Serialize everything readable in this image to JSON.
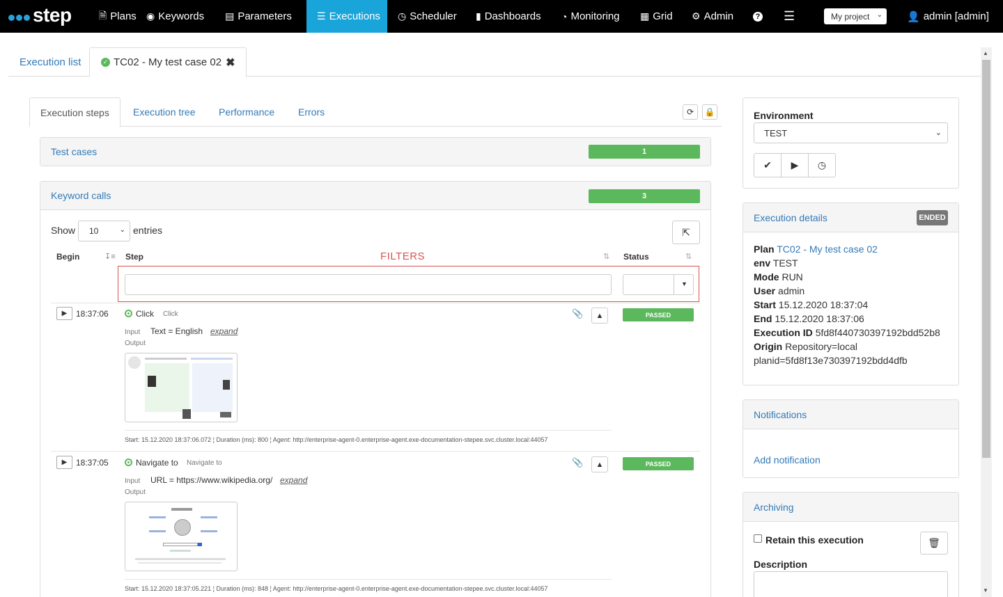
{
  "nav": {
    "brand": "step",
    "items": [
      {
        "label": "Plans",
        "icon": "file-icon"
      },
      {
        "label": "Keywords",
        "icon": "target-icon"
      },
      {
        "label": "Parameters",
        "icon": "list-icon"
      },
      {
        "label": "Executions",
        "icon": "tasks-icon"
      },
      {
        "label": "Scheduler",
        "icon": "clock-icon"
      },
      {
        "label": "Dashboards",
        "icon": "bar-chart-icon"
      },
      {
        "label": "Monitoring",
        "icon": "dashboard-icon"
      },
      {
        "label": "Grid",
        "icon": "grid-icon"
      },
      {
        "label": "Admin",
        "icon": "gear-icon"
      }
    ],
    "project": "My project",
    "user": "admin [admin]"
  },
  "page_tabs": {
    "list": "Execution list",
    "current": "TC02 - My test case 02"
  },
  "inner_tabs": [
    "Execution steps",
    "Execution tree",
    "Performance",
    "Errors"
  ],
  "test_cases": {
    "label": "Test cases",
    "count": "1"
  },
  "keyword_calls": {
    "label": "Keyword calls",
    "count": "3",
    "show": "Show",
    "page_size": "10",
    "entries": "entries",
    "filters_label": "FILTERS",
    "columns": {
      "begin": "Begin",
      "step": "Step",
      "status": "Status"
    },
    "rows": [
      {
        "time": "18:37:06",
        "name": "Click",
        "type": "Click",
        "input_label": "Input",
        "input": "Text = English",
        "expand": "expand",
        "output_label": "Output",
        "status": "PASSED",
        "meta": "Start: 15.12.2020 18:37:06.072 ¦ Duration (ms): 800 ¦ Agent: http://enterprise-agent-0.enterprise-agent.exe-documentation-stepee.svc.cluster.local:44057"
      },
      {
        "time": "18:37:05",
        "name": "Navigate to",
        "type": "Navigate to",
        "input_label": "Input",
        "input": "URL = https://www.wikipedia.org/",
        "expand": "expand",
        "output_label": "Output",
        "status": "PASSED",
        "meta": "Start: 15.12.2020 18:37:05.221 ¦ Duration (ms): 848 ¦ Agent: http://enterprise-agent-0.enterprise-agent.exe-documentation-stepee.svc.cluster.local:44057"
      }
    ]
  },
  "environment": {
    "label": "Environment",
    "value": "TEST"
  },
  "execution_details": {
    "title": "Execution details",
    "state": "ENDED",
    "plan_label": "Plan",
    "plan": "TC02 - My test case 02",
    "env_label": "env",
    "env": "TEST",
    "mode_label": "Mode",
    "mode": "RUN",
    "user_label": "User",
    "user": "admin",
    "start_label": "Start",
    "start": "15.12.2020 18:37:04",
    "end_label": "End",
    "end": "15.12.2020 18:37:06",
    "id_label": "Execution ID",
    "id": "5fd8f440730397192bdd52b8",
    "origin_label": "Origin",
    "origin": "Repository=local",
    "origin2": "planid=5fd8f13e730397192bdd4dfb"
  },
  "notifications": {
    "title": "Notifications",
    "add": "Add notification"
  },
  "archiving": {
    "title": "Archiving",
    "retain": "Retain this execution",
    "description": "Description"
  }
}
